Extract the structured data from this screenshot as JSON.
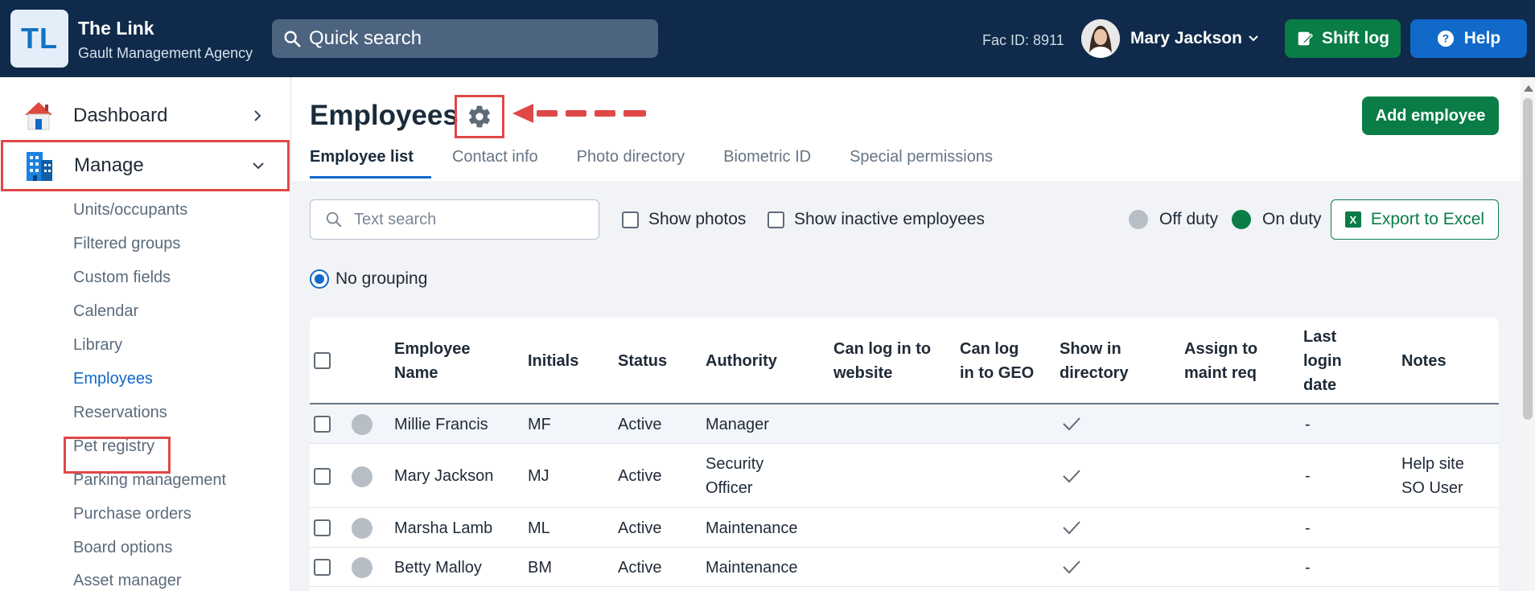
{
  "header": {
    "logo_text": "TL",
    "app_title": "The Link",
    "app_subtitle": "Gault Management Agency",
    "search_placeholder": "Quick search",
    "fac_id": "Fac ID: 8911",
    "user_name": "Mary Jackson",
    "shift_log_label": "Shift log",
    "help_label": "Help"
  },
  "sidebar": {
    "dashboard_label": "Dashboard",
    "manage_label": "Manage",
    "sub_items": [
      "Units/occupants",
      "Filtered groups",
      "Custom fields",
      "Calendar",
      "Library",
      "Employees",
      "Reservations",
      "Pet registry",
      "Parking management",
      "Purchase orders",
      "Board options",
      "Asset manager"
    ]
  },
  "page": {
    "title": "Employees",
    "add_button": "Add employee",
    "tabs": [
      "Employee list",
      "Contact info",
      "Photo directory",
      "Biometric ID",
      "Special permissions"
    ],
    "search_placeholder": "Text search",
    "show_photos": "Show photos",
    "show_inactive": "Show inactive employees",
    "legend_off": "Off duty",
    "legend_on": "On duty",
    "export_label": "Export to Excel",
    "grouping_label": "No grouping"
  },
  "colors": {
    "off_duty": "#b8bec6",
    "on_duty": "#0a7d47",
    "accent": "#1169c9",
    "brand_dark": "#0f2a4a"
  },
  "table": {
    "headers": {
      "name": [
        "Employee",
        "Name"
      ],
      "initials": "Initials",
      "status": "Status",
      "authority": "Authority",
      "website": [
        "Can log in to",
        "website"
      ],
      "geo": [
        "Can log",
        "in to GEO"
      ],
      "directory": [
        "Show in",
        "directory"
      ],
      "maint": [
        "Assign to",
        "maint req"
      ],
      "last_login": [
        "Last",
        "login",
        "date"
      ],
      "notes": "Notes"
    },
    "rows": [
      {
        "name": "Millie Francis",
        "initials": "MF",
        "status": "Active",
        "authority": [
          "Manager"
        ],
        "last_login": "-",
        "notes": []
      },
      {
        "name": "Mary Jackson",
        "initials": "MJ",
        "status": "Active",
        "authority": [
          "Security",
          "Officer"
        ],
        "last_login": "-",
        "notes": [
          "Help site",
          "SO User"
        ]
      },
      {
        "name": "Marsha Lamb",
        "initials": "ML",
        "status": "Active",
        "authority": [
          "Maintenance"
        ],
        "last_login": "-",
        "notes": []
      },
      {
        "name": "Betty Malloy",
        "initials": "BM",
        "status": "Active",
        "authority": [
          "Maintenance"
        ],
        "last_login": "-",
        "notes": []
      }
    ]
  }
}
